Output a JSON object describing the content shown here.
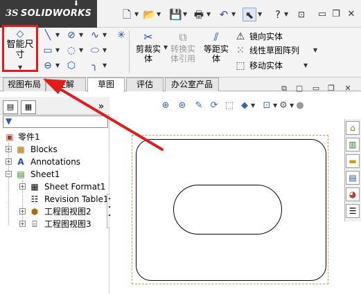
{
  "app": {
    "brand_prefix": "3S",
    "brand": "SOLIDWORKS"
  },
  "colors": {
    "highlight_box": "#e21b1b",
    "arrow": "#e21b1b",
    "accent_blue": "#1f4ea8",
    "sheet_border": "#e39a4a"
  },
  "quick_access": {
    "icons": [
      "new-document-icon",
      "open-folder-icon",
      "save-icon",
      "print-icon",
      "undo-icon",
      "select-pointer-icon",
      "help-icon",
      "pin-icon"
    ]
  },
  "commands": {
    "smart_dimension": {
      "label": "智能尺寸",
      "icon": "smart-dimension-icon"
    },
    "trim_entities": {
      "label": "剪裁实体",
      "icon": "trim-icon"
    },
    "convert_entities": {
      "label": "转换实体引用",
      "icon": "convert-icon"
    },
    "offset_entities": {
      "label": "等距实体",
      "icon": "offset-icon"
    },
    "mirror_entities": {
      "label": "镜向实体",
      "icon": "mirror-icon"
    },
    "linear_pattern": {
      "label": "线性草图阵列",
      "icon": "linear-pattern-icon"
    },
    "move_entities": {
      "label": "移动实体",
      "icon": "move-icon"
    },
    "sketch_tools": [
      "line-icon",
      "circle-icon",
      "spline-icon",
      "point-icon",
      "rectangle-icon",
      "arc-icon",
      "ellipse-icon",
      "slot-icon",
      "polygon-icon",
      "fillet-icon"
    ]
  },
  "tabs": [
    {
      "label": "视图布局",
      "active": false
    },
    {
      "label": "注解",
      "active": false
    },
    {
      "label": "草图",
      "active": true
    },
    {
      "label": "评估",
      "active": false
    },
    {
      "label": "办公室产品",
      "active": false
    }
  ],
  "feature_tree": {
    "expand_label": "»",
    "root": "零件1",
    "items": [
      {
        "label": "Blocks",
        "icon": "blocks-icon",
        "expand": "+"
      },
      {
        "label": "Annotations",
        "icon": "annotations-icon",
        "expand": "+"
      },
      {
        "label": "Sheet1",
        "icon": "sheet-icon",
        "expand": "−"
      },
      {
        "label": "Sheet Format1",
        "icon": "sheet-format-icon",
        "expand": "+"
      },
      {
        "label": "Revision Table1",
        "icon": "revision-table-icon",
        "expand": ""
      },
      {
        "label": "工程图视图2",
        "icon": "drawing-view-icon",
        "expand": "+"
      },
      {
        "label": "工程图视图3",
        "icon": "drawing-view-icon",
        "expand": "+"
      }
    ]
  },
  "view_toolbar": {
    "icons": [
      "zoom-to-fit-icon",
      "zoom-area-icon",
      "previous-view-icon",
      "rotate-icon",
      "view-orientation-icon",
      "display-style-icon",
      "hide-show-icon",
      "appearance-icon"
    ]
  },
  "task_pane": {
    "icons": [
      "home-icon",
      "design-library-icon",
      "file-explorer-icon",
      "view-palette-icon",
      "appearances-icon",
      "custom-properties-icon"
    ]
  }
}
